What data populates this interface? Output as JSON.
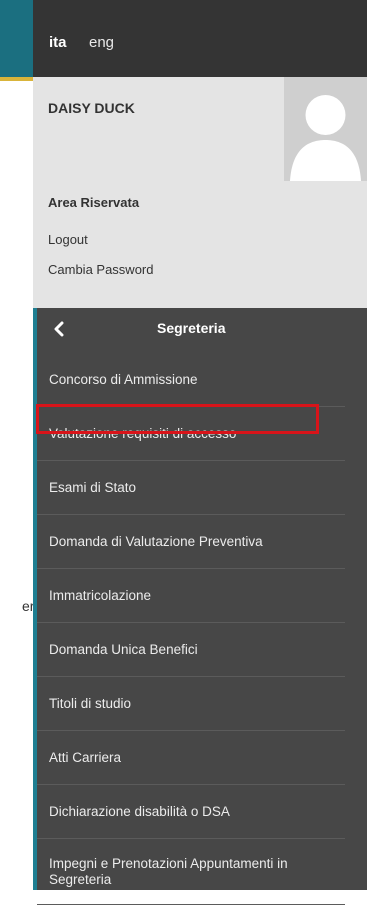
{
  "background": {
    "text_fragment": "er"
  },
  "language_switcher": {
    "current": "ita",
    "other": "eng"
  },
  "user": {
    "name": "DAISY DUCK",
    "area_title": "Area Riservata",
    "logout": "Logout",
    "change_password": "Cambia Password"
  },
  "menu": {
    "title": "Segreteria",
    "back_icon": "chevron-left-icon",
    "items": [
      {
        "label": "Concorso di Ammissione"
      },
      {
        "label": "Valutazione requisiti di accesso"
      },
      {
        "label": "Esami di Stato"
      },
      {
        "label": "Domanda di Valutazione Preventiva"
      },
      {
        "label": "Immatricolazione"
      },
      {
        "label": "Domanda Unica Benefici"
      },
      {
        "label": "Titoli di studio"
      },
      {
        "label": "Atti Carriera"
      },
      {
        "label": "Dichiarazione disabilità o DSA"
      },
      {
        "label": "Impegni e Prenotazioni Appuntamenti in Segreteria"
      }
    ],
    "highlighted_item": "Valutazione requisiti di accesso"
  },
  "colors": {
    "panel": "#474747",
    "accent": "#1f7f92",
    "highlight": "#d8141a"
  }
}
